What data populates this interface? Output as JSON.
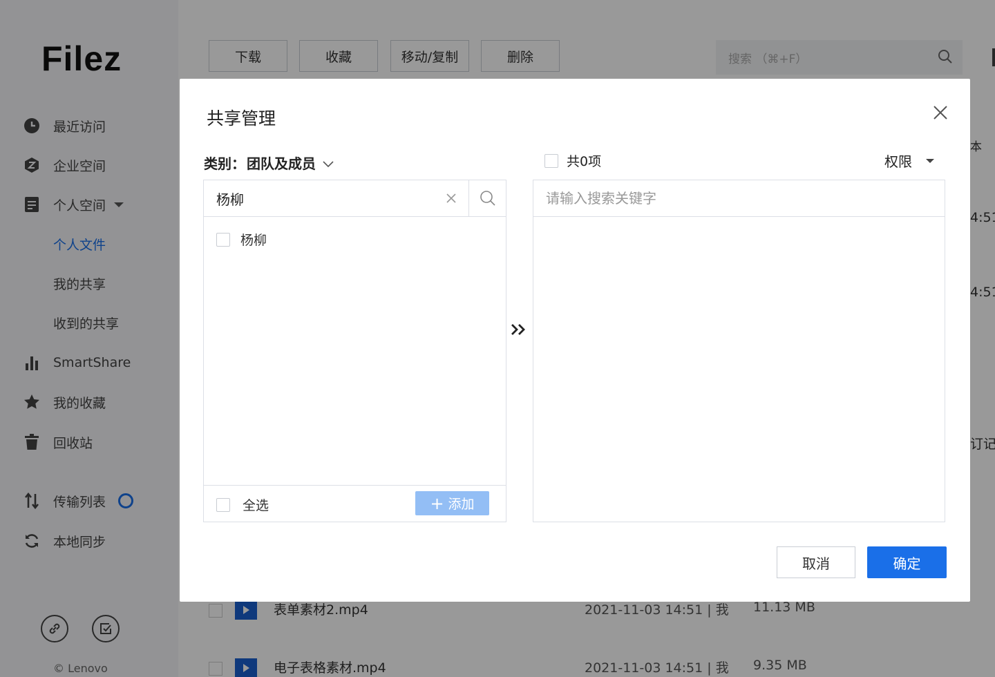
{
  "app": {
    "logo": "Filez",
    "copyright": "© Lenovo"
  },
  "sidebar": {
    "items": [
      {
        "label": "最近访问",
        "icon": "clock-icon"
      },
      {
        "label": "企业空间",
        "icon": "enterprise-icon"
      },
      {
        "label": "个人空间",
        "icon": "document-icon"
      },
      {
        "label": "个人文件"
      },
      {
        "label": "我的共享"
      },
      {
        "label": "收到的共享"
      },
      {
        "label": "SmartShare",
        "icon": "bar-chart-icon"
      },
      {
        "label": "我的收藏",
        "icon": "star-icon"
      },
      {
        "label": "回收站",
        "icon": "trash-icon"
      },
      {
        "label": "传输列表",
        "icon": "transfer-icon"
      },
      {
        "label": "本地同步",
        "icon": "sync-icon"
      }
    ]
  },
  "toolbar": {
    "download": "下载",
    "favorite": "收藏",
    "move_copy": "移动/复制",
    "delete": "删除"
  },
  "top_search": {
    "placeholder": "搜索 （⌘+F）"
  },
  "background": {
    "col_header_partial": "本",
    "time_partial_1": "4:51",
    "time_partial_2": "4:51",
    "text_partial": "订记录",
    "files": [
      {
        "name": "表单素材2.mp4",
        "date": "2021-11-03 14:51 | 我",
        "size": "11.13 MB"
      },
      {
        "name": "电子表格素材.mp4",
        "date": "2021-11-03 14:51 | 我",
        "size": "9.35 MB"
      }
    ]
  },
  "modal": {
    "title": "共享管理",
    "category_label": "类别：",
    "category_value": "团队及成员",
    "search_value": "杨柳",
    "results": [
      {
        "name": "杨柳"
      }
    ],
    "select_all": "全选",
    "add_button": "添加",
    "total_count": "共0项",
    "permission": "权限",
    "right_search_placeholder": "请输入搜索关键字",
    "cancel": "取消",
    "confirm": "确定"
  },
  "colors": {
    "primary": "#1a6fe8",
    "add_disabled": "#93bef5",
    "overlay": "rgba(0,0,0,0.4)"
  }
}
